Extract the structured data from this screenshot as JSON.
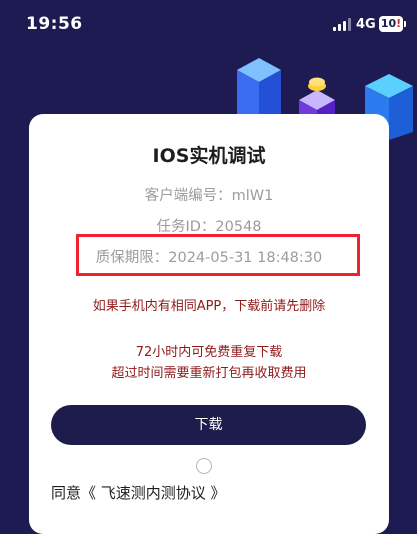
{
  "status_bar": {
    "time": "19:56",
    "network": "4G",
    "battery": "10",
    "battery_warning": "!"
  },
  "card": {
    "title": "IOS实机调试",
    "client_number": "客户端编号：mlW1",
    "task_id": "任务ID：20548",
    "warranty_period": "质保期限：2024-05-31 18:48:30",
    "notice_same_app": "如果手机内有相同APP，下载前请先删除",
    "notice_free_redownload": "72小时内可免费重复下载",
    "notice_repack_fee": "超过时间需要重新打包再收取费用",
    "download_label": "下载",
    "agreement_text": "同意《 飞速测内测协议 》"
  },
  "colors": {
    "background": "#1d1b52",
    "card": "#ffffff",
    "highlight": "#ef2330",
    "warning_text": "#8f1a1a",
    "button": "#1e1c4c"
  },
  "icons": [
    "signal-icon",
    "battery-icon",
    "decorative-cubes-icon",
    "radio-icon"
  ]
}
